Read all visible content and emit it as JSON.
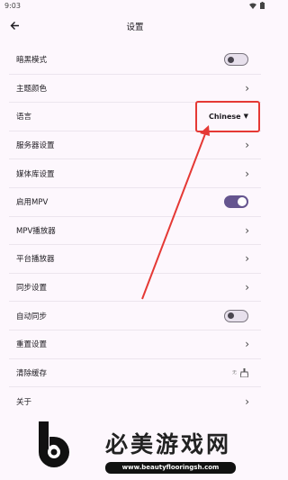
{
  "status_bar": {
    "time": "9:03"
  },
  "app_bar": {
    "title": "设置",
    "back_icon": "arrow-left-icon"
  },
  "settings": {
    "dark_mode": {
      "label": "暗黑模式",
      "enabled": false
    },
    "theme_color": {
      "label": "主题颜色"
    },
    "language": {
      "label": "语言",
      "value": "Chinese"
    },
    "server_settings": {
      "label": "服务器设置"
    },
    "media_library": {
      "label": "媒体库设置"
    },
    "enable_mpv": {
      "label": "启用MPV",
      "enabled": true
    },
    "mpv_player": {
      "label": "MPV播放器"
    },
    "platform_player": {
      "label": "平台播放器"
    },
    "sync_settings": {
      "label": "同步设置"
    },
    "auto_sync": {
      "label": "自动同步",
      "enabled": false
    },
    "reset_settings": {
      "label": "重置设置"
    },
    "clear_cache": {
      "label": "清除缓存",
      "size": "无"
    },
    "about": {
      "label": "关于"
    }
  },
  "annotation": {
    "color": "#e53935"
  },
  "watermark": {
    "title": "必美游戏网",
    "url": "www.beautyflooringsh.com"
  },
  "colors": {
    "accent": "#65558f",
    "background": "#fdf7fd"
  }
}
